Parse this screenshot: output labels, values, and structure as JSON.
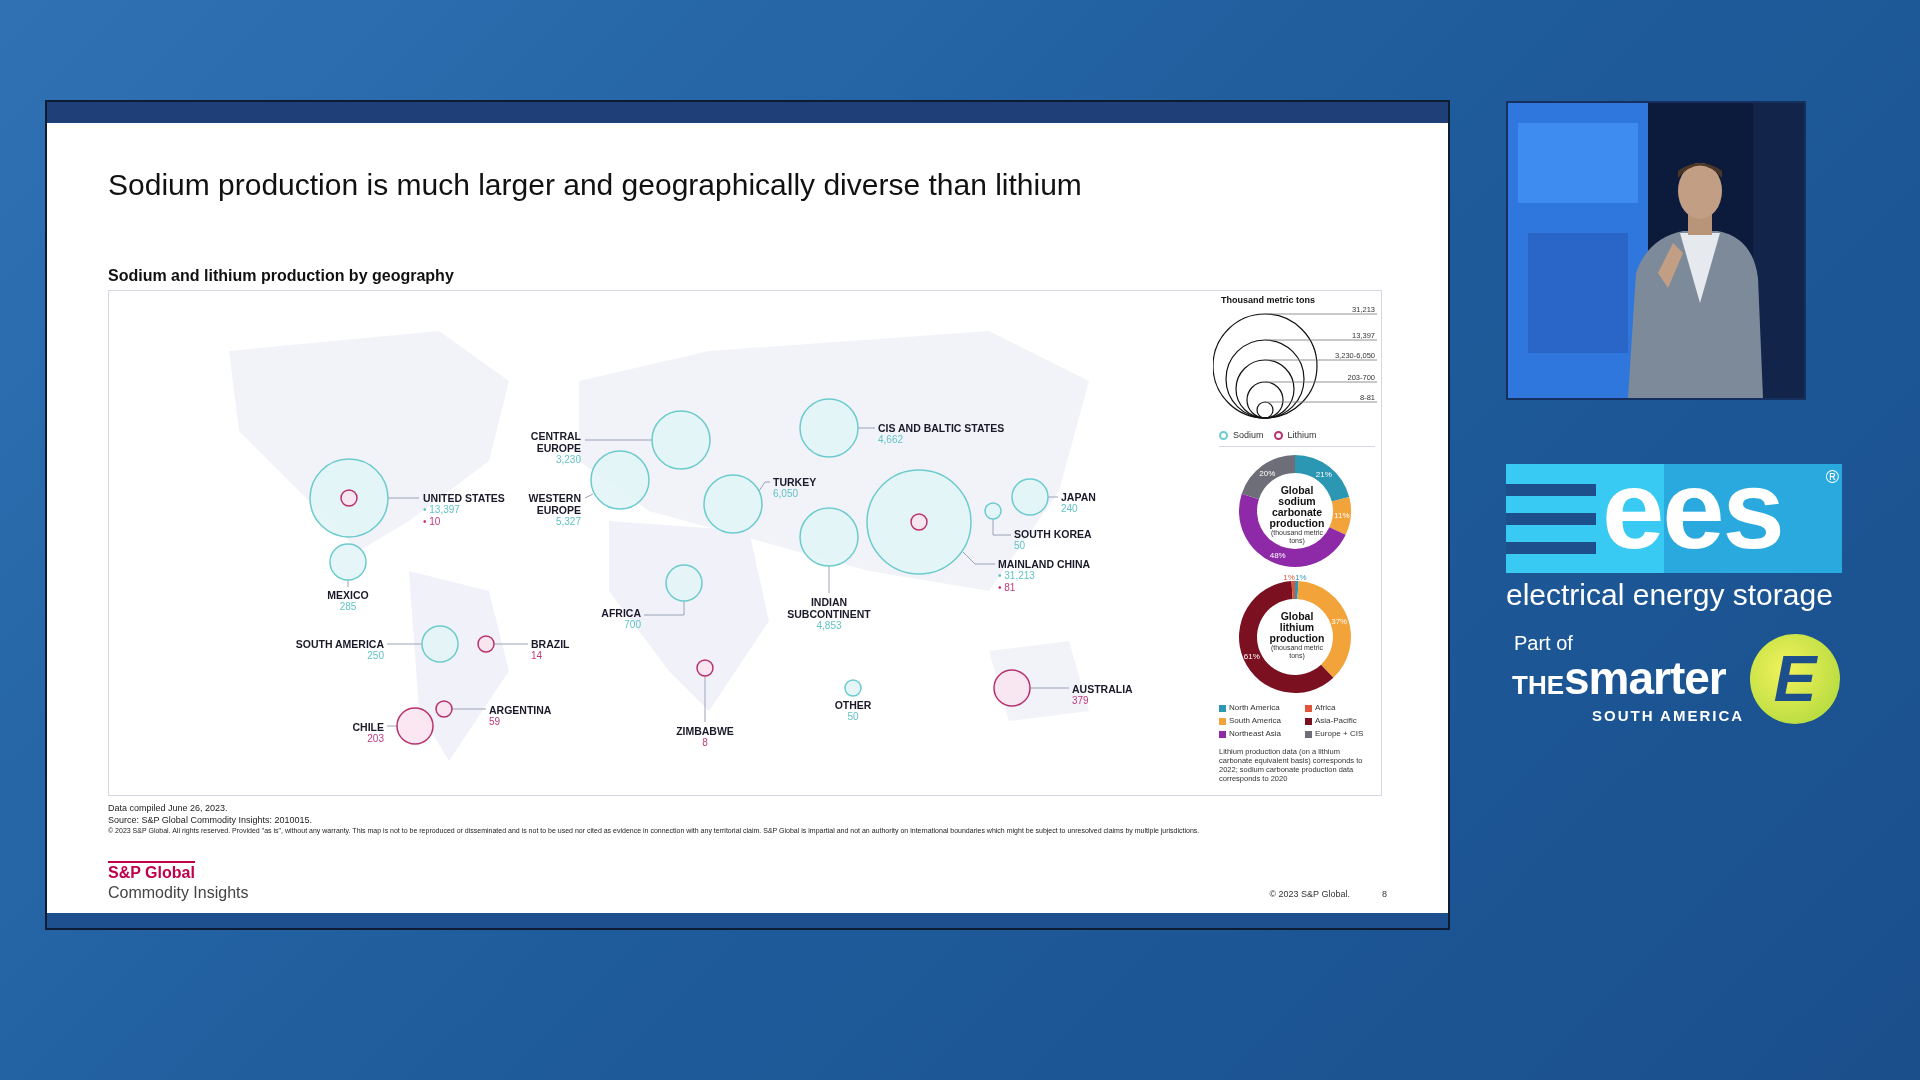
{
  "slide": {
    "title": "Sodium production is much larger and geographically diverse than lithium",
    "chart_title": "Sodium and lithium production by geography",
    "map": {
      "regions": [
        {
          "name": "CENTRAL EUROPE",
          "values": [
            {
              "kind": "sodium",
              "text": "3,230"
            }
          ]
        },
        {
          "name": "CIS AND BALTIC STATES",
          "values": [
            {
              "kind": "sodium",
              "text": "4,662"
            }
          ]
        },
        {
          "name": "UNITED STATES",
          "values": [
            {
              "kind": "sodium",
              "text": "• 13,397"
            },
            {
              "kind": "lithium",
              "text": "• 10"
            }
          ]
        },
        {
          "name": "WESTERN EUROPE",
          "values": [
            {
              "kind": "sodium",
              "text": "5,327"
            }
          ]
        },
        {
          "name": "TURKEY",
          "values": [
            {
              "kind": "sodium",
              "text": "6,050"
            }
          ]
        },
        {
          "name": "JAPAN",
          "values": [
            {
              "kind": "sodium",
              "text": "240"
            }
          ]
        },
        {
          "name": "SOUTH KOREA",
          "values": [
            {
              "kind": "sodium",
              "text": "50"
            }
          ]
        },
        {
          "name": "MAINLAND CHINA",
          "values": [
            {
              "kind": "sodium",
              "text": "• 31,213"
            },
            {
              "kind": "lithium",
              "text": "• 81"
            }
          ]
        },
        {
          "name": "MEXICO",
          "values": [
            {
              "kind": "sodium",
              "text": "285"
            }
          ]
        },
        {
          "name": "AFRICA",
          "values": [
            {
              "kind": "sodium",
              "text": "700"
            }
          ]
        },
        {
          "name": "INDIAN SUBCONTINENT",
          "values": [
            {
              "kind": "sodium",
              "text": "4,853"
            }
          ]
        },
        {
          "name": "SOUTH AMERICA",
          "values": [
            {
              "kind": "sodium",
              "text": "250"
            }
          ]
        },
        {
          "name": "BRAZIL",
          "values": [
            {
              "kind": "lithium",
              "text": "14"
            }
          ]
        },
        {
          "name": "ARGENTINA",
          "values": [
            {
              "kind": "lithium",
              "text": "59"
            }
          ]
        },
        {
          "name": "CHILE",
          "values": [
            {
              "kind": "lithium",
              "text": "203"
            }
          ]
        },
        {
          "name": "ZIMBABWE",
          "values": [
            {
              "kind": "lithium",
              "text": "8"
            }
          ]
        },
        {
          "name": "OTHER",
          "values": [
            {
              "kind": "sodium",
              "text": "50"
            }
          ]
        },
        {
          "name": "AUSTRALIA",
          "values": [
            {
              "kind": "lithium",
              "text": "379"
            }
          ]
        }
      ]
    },
    "size_legend": {
      "title": "Thousand metric tons",
      "steps": [
        "31,213",
        "13,397",
        "3,230-6,050",
        "203-700",
        "8-81"
      ]
    },
    "series_legend": [
      {
        "kind": "sodium",
        "label": "Sodium"
      },
      {
        "kind": "lithium",
        "label": "Lithium"
      }
    ],
    "donuts": [
      {
        "unit": "(thousand metric tons)",
        "chart_data": {
          "type": "donut",
          "title": "Global sodium carbonate production",
          "values": [
            21,
            11,
            48,
            20
          ],
          "colors": [
            "#2b97b3",
            "#f2a33a",
            "#8e2aa8",
            "#6e6e78"
          ],
          "value_labels": [
            "21%",
            "11%",
            "48%",
            "20%"
          ]
        }
      },
      {
        "unit": "(thousand metric tons)",
        "chart_data": {
          "type": "donut",
          "title": "Global lithium production",
          "values": [
            1,
            37,
            61,
            1
          ],
          "colors": [
            "#2b97b3",
            "#f2a33a",
            "#7a1020",
            "#e0553a"
          ],
          "value_labels": [
            "1%",
            "37%",
            "61%",
            "1%"
          ]
        }
      }
    ],
    "region_legend": [
      {
        "label": "North America",
        "color": "#2b97b3"
      },
      {
        "label": "Africa",
        "color": "#e0553a"
      },
      {
        "label": "South America",
        "color": "#f2a33a"
      },
      {
        "label": "Asia-Pacific",
        "color": "#7a1020"
      },
      {
        "label": "Northeast Asia",
        "color": "#8e2aa8"
      },
      {
        "label": "Europe + CIS",
        "color": "#6e6e78"
      }
    ],
    "note": "Lithium production data (on a lithium carbonate equivalent basis) corresponds to 2022; sodium carbonate production data corresponds to 2020",
    "footnotes": [
      "Data compiled June 26, 2023.",
      "Source: S&P Global Commodity Insights: 2010015."
    ],
    "fine_print": "© 2023 S&P Global. All rights reserved. Provided \"as is\", without any warranty. This map is not to be reproduced or disseminated and is not to be used nor cited as evidence in connection with any territorial claim. S&P Global is impartial and not an authority on international boundaries which might be subject to unresolved claims by multiple jurisdictions.",
    "brand": {
      "name": "S&P Global",
      "division": "Commodity Insights"
    },
    "copyright": "© 2023 S&P Global.",
    "page_number": "8"
  },
  "event_logo": {
    "mark": "ees",
    "registered": "®",
    "tagline": "electrical energy storage",
    "part_of": "Part of",
    "the": "THE",
    "smarter": "smarter",
    "region": "SOUTH AMERICA",
    "e_mark": "E"
  }
}
